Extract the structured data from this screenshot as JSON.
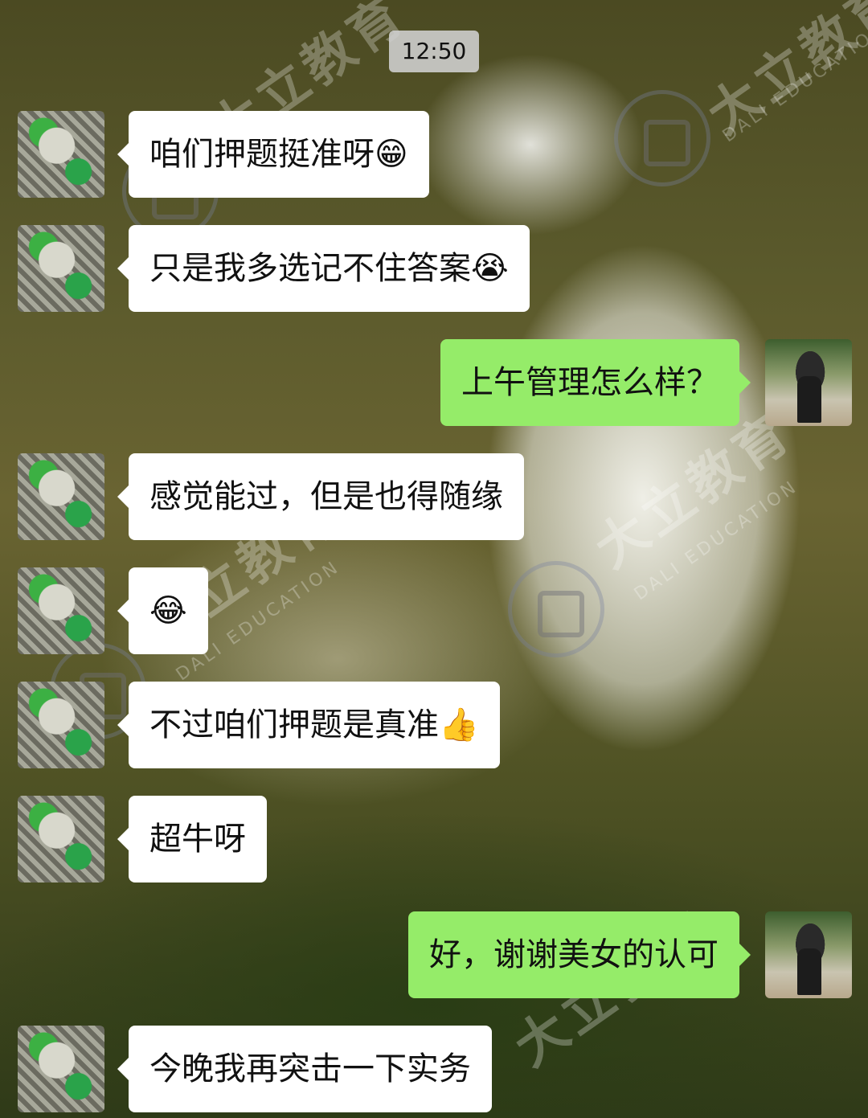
{
  "status": {
    "time": "12:50"
  },
  "watermarks": {
    "brand_cn": "大立教育",
    "brand_en": "DALI EDUCATION"
  },
  "messages": [
    {
      "side": "in",
      "text": "咱们押题挺准呀😁"
    },
    {
      "side": "in",
      "text": "只是我多选记不住答案😭"
    },
    {
      "side": "out",
      "text": "上午管理怎么样？"
    },
    {
      "side": "in",
      "text": "感觉能过，但是也得随缘"
    },
    {
      "side": "in",
      "text": "😂"
    },
    {
      "side": "in",
      "text": "不过咱们押题是真准👍"
    },
    {
      "side": "in",
      "text": "超牛呀"
    },
    {
      "side": "out",
      "text": "好，谢谢美女的认可"
    },
    {
      "side": "in",
      "text": "今晚我再突击一下实务"
    }
  ],
  "colors": {
    "incoming_bubble": "#ffffff",
    "outgoing_bubble": "#95ec69",
    "time_badge": "#d2d2d2"
  }
}
